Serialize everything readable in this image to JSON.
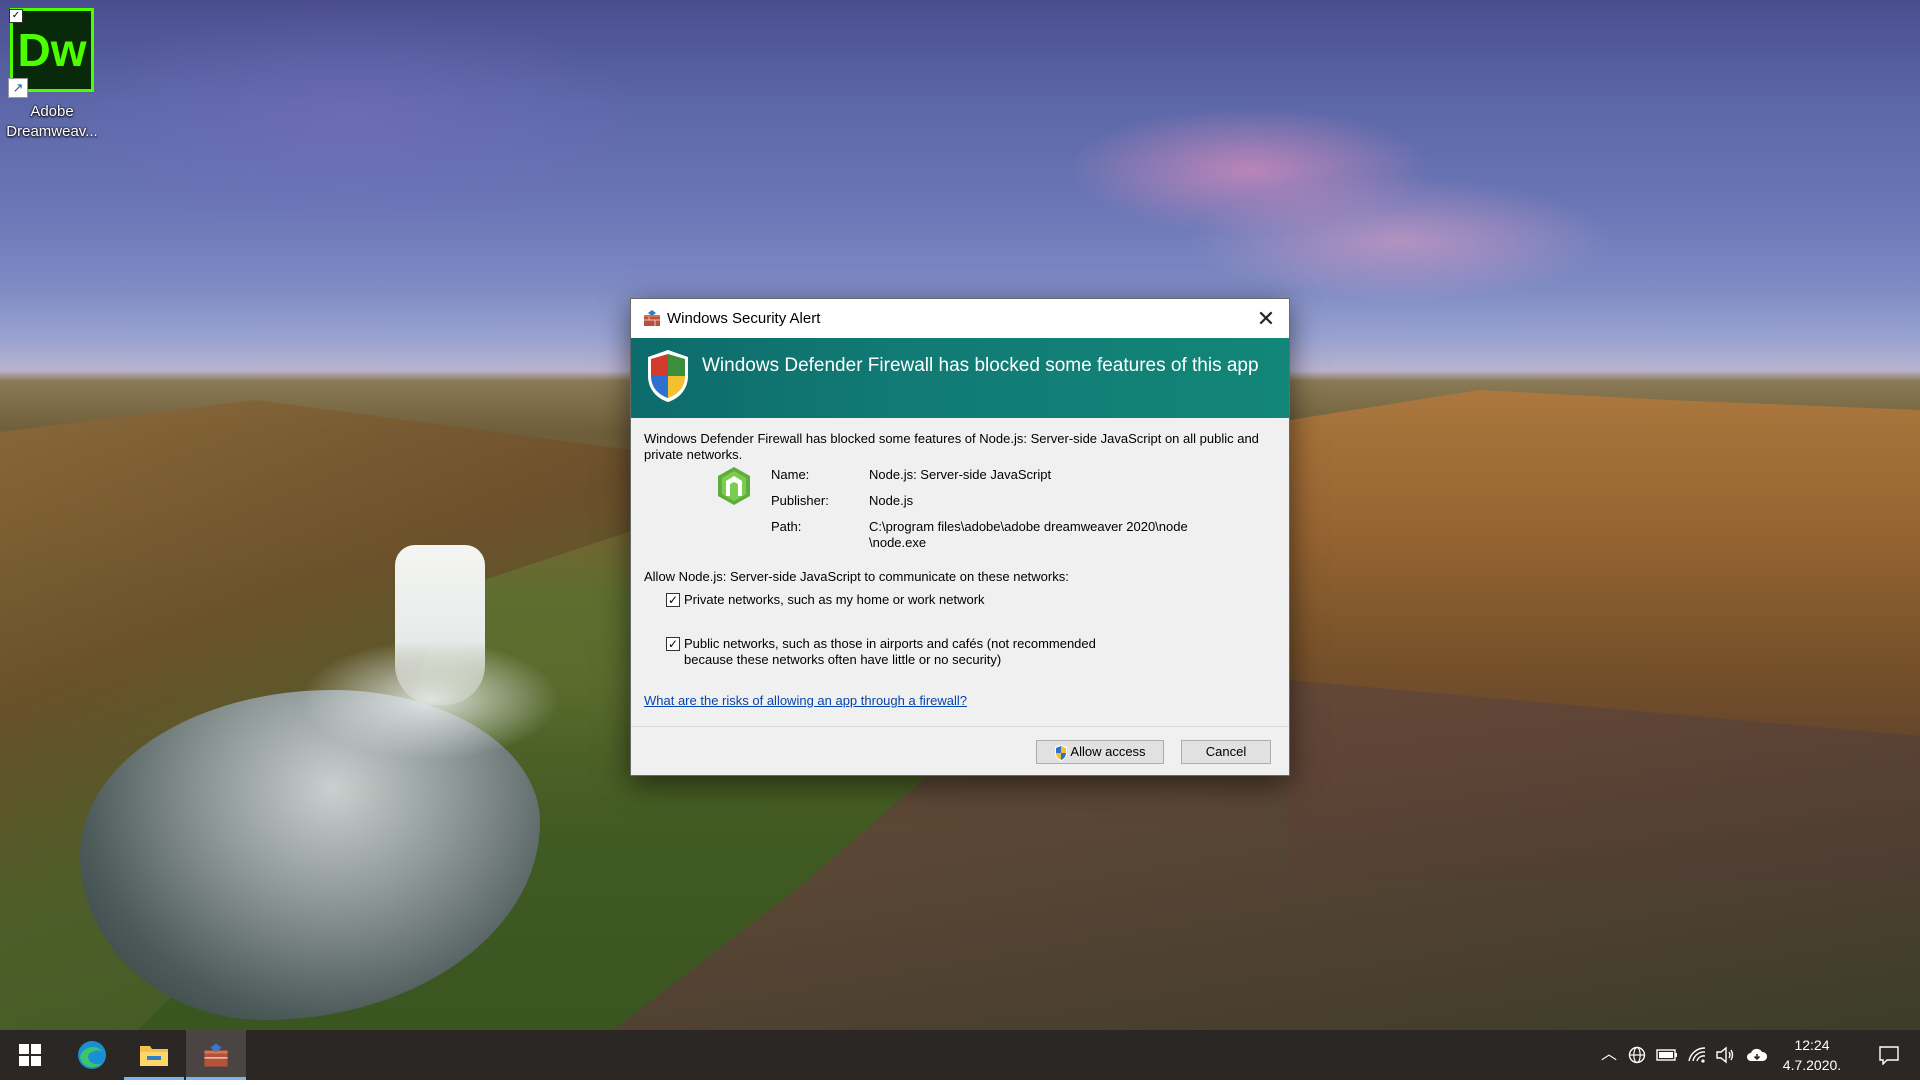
{
  "desktop": {
    "icons": [
      {
        "label": "Adobe Dreamweav...",
        "glyph": "Dw",
        "accent": "#4cff00"
      }
    ]
  },
  "dialog": {
    "title": "Windows Security Alert",
    "headline": "Windows Defender Firewall has blocked some features of this app",
    "intro": "Windows Defender Firewall has blocked some features of Node.js: Server-side JavaScript on all public and private networks.",
    "fields": [
      {
        "label": "Name:",
        "value": "Node.js: Server-side JavaScript"
      },
      {
        "label": "Publisher:",
        "value": "Node.js"
      },
      {
        "label": "Path:",
        "value": "C:\\program files\\adobe\\adobe dreamweaver 2020\\node \\node.exe"
      }
    ],
    "allow_prompt": "Allow Node.js: Server-side JavaScript to communicate on these networks:",
    "options": [
      {
        "label": "Private networks, such as my home or work network",
        "checked": true
      },
      {
        "label": "Public networks, such as those in airports and cafés (not recommended because these networks often have little or no security)",
        "checked": true
      }
    ],
    "risk_link": "What are the risks of allowing an app through a firewall?",
    "buttons": {
      "allow": "Allow access",
      "cancel": "Cancel"
    },
    "banner_color": "#117a74"
  },
  "taskbar": {
    "apps": [
      "start-icon",
      "edge-icon",
      "file-explorer-icon",
      "firewall-app-icon"
    ],
    "tray": [
      "chevron-up-icon",
      "language-icon",
      "battery-icon",
      "wifi-icon",
      "volume-icon",
      "onedrive-icon"
    ],
    "clock": {
      "time": "12:24",
      "date": "4.7.2020."
    }
  }
}
